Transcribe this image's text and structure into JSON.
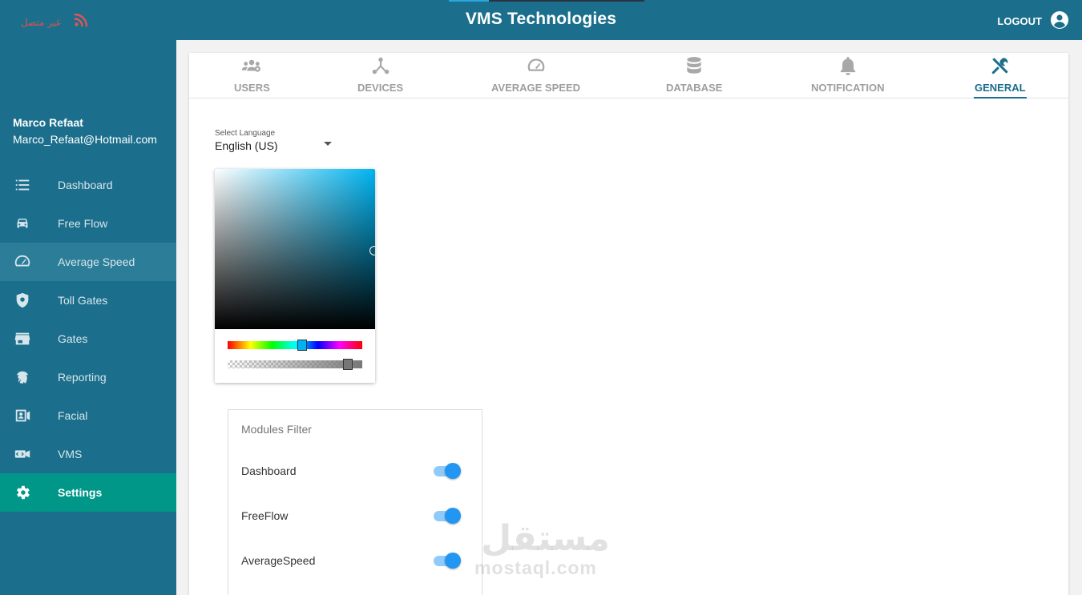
{
  "header": {
    "title": "VMS Technologies",
    "status_text": "غير متصل",
    "logout_label": "LOGOUT"
  },
  "user": {
    "name": "Marco Refaat",
    "email": "Marco_Refaat@Hotmail.com"
  },
  "sidebar": {
    "items": [
      {
        "label": "Dashboard",
        "icon": "list-icon"
      },
      {
        "label": "Free Flow",
        "icon": "car-icon"
      },
      {
        "label": "Average Speed",
        "icon": "speedometer-icon"
      },
      {
        "label": "Toll Gates",
        "icon": "shield-icon"
      },
      {
        "label": "Gates",
        "icon": "store-icon"
      },
      {
        "label": "Reporting",
        "icon": "fingerprint-icon"
      },
      {
        "label": "Facial",
        "icon": "contact-card-icon"
      },
      {
        "label": "VMS",
        "icon": "video-camera-icon"
      },
      {
        "label": "Settings",
        "icon": "gear-icon"
      }
    ],
    "hovered": "Average Speed",
    "active": "Settings"
  },
  "tabs": [
    {
      "label": "USERS",
      "icon": "users-icon"
    },
    {
      "label": "DEVICES",
      "icon": "devices-icon"
    },
    {
      "label": "AVERAGE SPEED",
      "icon": "gauge-icon"
    },
    {
      "label": "DATABASE",
      "icon": "database-icon"
    },
    {
      "label": "NOTIFICATION",
      "icon": "bell-icon"
    },
    {
      "label": "GENERAL",
      "icon": "tools-icon"
    }
  ],
  "active_tab": "GENERAL",
  "language": {
    "caption": "Select Language",
    "value": "English (US)"
  },
  "color_picker": {
    "base_color": "#00b4f0"
  },
  "modules_filter": {
    "title": "Modules Filter",
    "items": [
      {
        "label": "Dashboard",
        "enabled": true
      },
      {
        "label": "FreeFlow",
        "enabled": true
      },
      {
        "label": "AverageSpeed",
        "enabled": true
      }
    ]
  },
  "watermark": {
    "arabic": "مستقل",
    "latin": "mostaql.com"
  },
  "colors": {
    "primary": "#1b6f8c",
    "active_nav": "#009688",
    "toggle_on": "#2196f3",
    "status_offline": "#d9534f"
  }
}
